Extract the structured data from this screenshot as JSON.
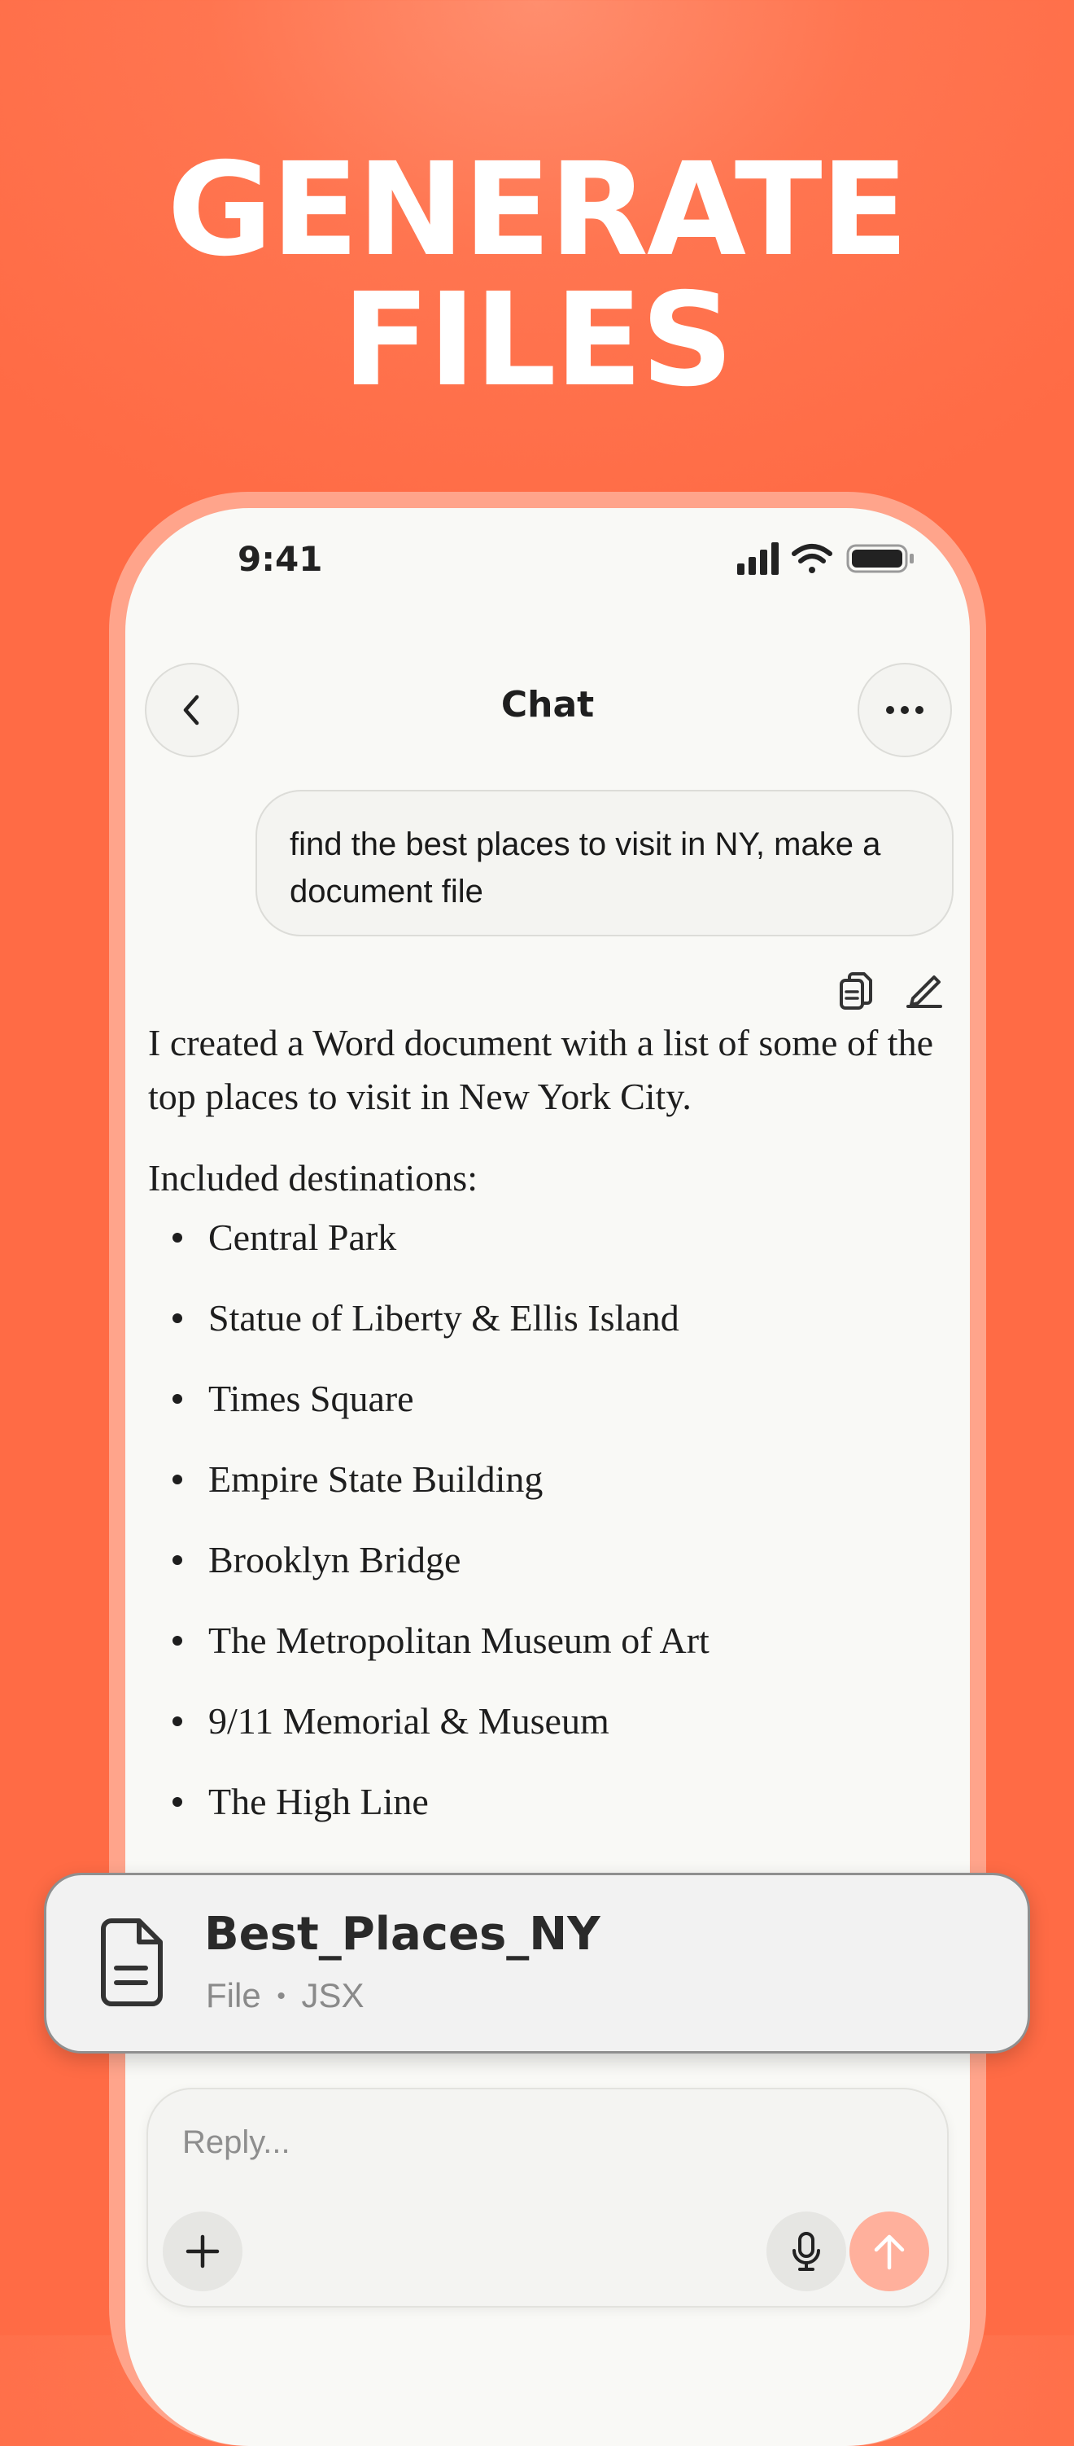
{
  "headline": {
    "line1": "GENERATE",
    "line2": "FILES"
  },
  "status_bar": {
    "time": "9:41"
  },
  "nav": {
    "title": "Chat",
    "back_icon": "chevron-left-icon",
    "more_icon": "ellipsis-icon"
  },
  "user_message": {
    "text": "find the best places to visit in NY, make a document file"
  },
  "message_actions": {
    "copy_icon": "copy-icon",
    "edit_icon": "edit-icon"
  },
  "assistant_message": {
    "intro": "I created a Word document with a list of some of the top places to visit in New York City.",
    "list_heading": "Included destinations:",
    "destinations": [
      "Central Park",
      "Statue of Liberty & Ellis Island",
      "Times Square",
      "Empire State Building",
      "Brooklyn Bridge",
      "The Metropolitan Museum of Art",
      "9/11 Memorial & Museum",
      "The High Line"
    ]
  },
  "file_card": {
    "name": "Best_Places_NY",
    "type_label": "File",
    "separator": "•",
    "extension": "JSX"
  },
  "composer": {
    "placeholder": "Reply...",
    "plus_icon": "plus-icon",
    "mic_icon": "mic-icon",
    "send_icon": "arrow-up-icon"
  },
  "colors": {
    "background": "#ff7550",
    "send_button": "#ffb09c",
    "text": "#1e1e1e"
  }
}
